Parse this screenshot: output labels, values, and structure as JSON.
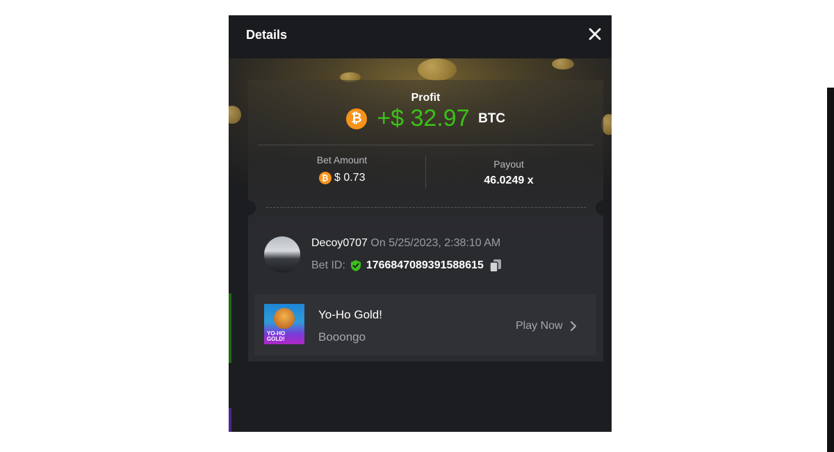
{
  "modal": {
    "title": "Details",
    "close_icon": "close-icon"
  },
  "profit": {
    "label": "Profit",
    "currency_icon": "bitcoin-icon",
    "currency_icon_glyph": "₿",
    "value": "+$ 32.97",
    "currency": "BTC"
  },
  "bet_amount": {
    "label": "Bet Amount",
    "value": "$ 0.73"
  },
  "payout": {
    "label": "Payout",
    "value": "46.0249 x"
  },
  "user": {
    "name": "Decoy0707",
    "timestamp": "On 5/25/2023, 2:38:10 AM",
    "bet_id_label": "Bet ID:",
    "bet_id": "1766847089391588615",
    "verified_icon": "shield-check-icon",
    "copy_icon": "copy-icon"
  },
  "game": {
    "title": "Yo-Ho Gold!",
    "provider": "Booongo",
    "thumbnail_text": "YO-HO GOLD!",
    "play_label": "Play Now",
    "play_icon": "chevron-right-icon"
  },
  "colors": {
    "profit_green": "#3bc117",
    "bitcoin_orange": "#f7931a",
    "modal_bg": "#1c1d20",
    "card_bg": "#2a2b2f"
  }
}
